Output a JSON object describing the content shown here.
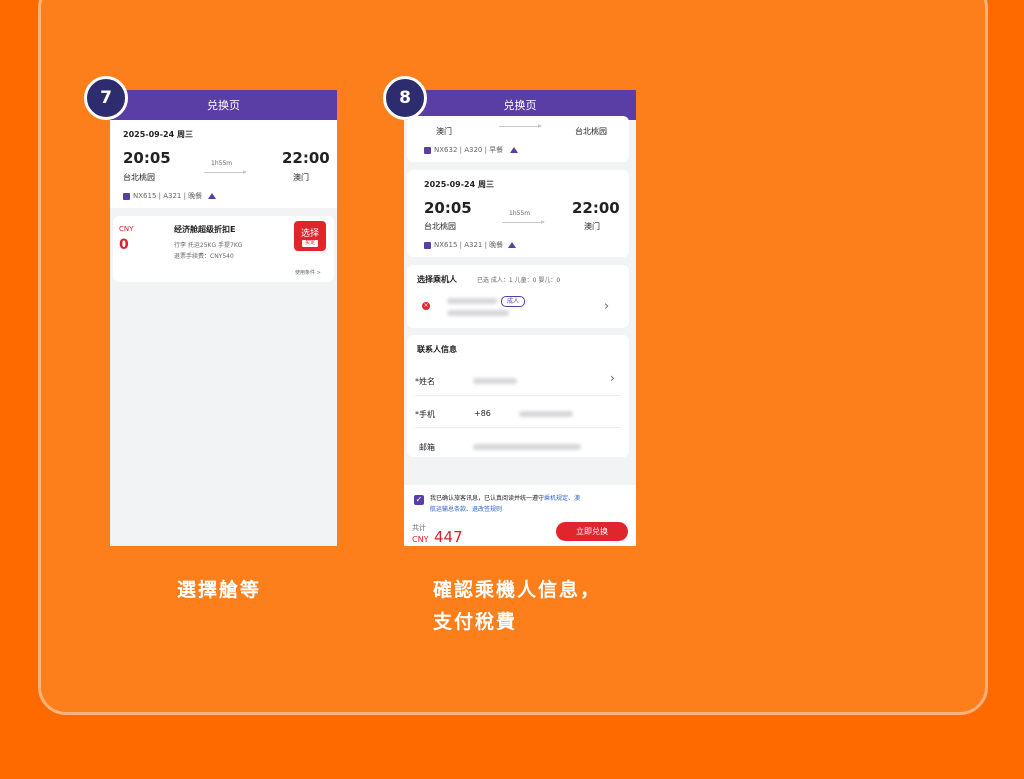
{
  "steps": [
    {
      "number": "7",
      "caption": "選擇艙等"
    },
    {
      "number": "8",
      "caption_line1": "確認乘機人信息，",
      "caption_line2": "支付稅費"
    }
  ],
  "screen7": {
    "title": "兑换页",
    "date": "2025-09-24 周三",
    "dep_time": "20:05",
    "arr_time": "22:00",
    "duration": "1h55m",
    "dep_city": "台北桃园",
    "arr_city": "澳门",
    "flight_info": "NX615 | A321 | 晚餐",
    "fare": {
      "currency": "CNY",
      "price": "0",
      "name": "经济舱超级折扣E",
      "baggage": "行李 托运25KG 手提7KG",
      "fee": "退票手续费：CNY540",
      "select": "选择",
      "select_sub": "买定",
      "rules": "使用条件 >"
    }
  },
  "screen8": {
    "title": "兑换页",
    "prev_dep_city": "澳门",
    "prev_arr_city": "台北桃园",
    "prev_flight_info": "NX632 | A320 | 早餐",
    "date": "2025-09-24 周三",
    "dep_time": "20:05",
    "arr_time": "22:00",
    "duration": "1h55m",
    "dep_city": "台北桃园",
    "arr_city": "澳门",
    "flight_info": "NX615 | A321 | 晚餐",
    "passenger": {
      "title": "选择乘机人",
      "summary": "已选   成人：1  儿童：0  婴儿：0",
      "tag": "成人"
    },
    "contact": {
      "title": "联系人信息",
      "name_label": "*姓名",
      "phone_label": "*手机",
      "country_code": "+86",
      "email_label": "邮箱"
    },
    "consent": {
      "text": "我已确认旅客讯息，已认真阅读并统一遵守",
      "link1": "乘机规定、澳",
      "link2": "航运输总条款、退改签规则"
    },
    "total": {
      "label": "共计",
      "currency": "CNY",
      "amount": "447",
      "button": "立即兑换"
    }
  },
  "colors": {
    "background": "#ff6a00",
    "card": "#fd7f1c",
    "brand_purple": "#5a3ea5",
    "accent_red": "#e0262c"
  }
}
